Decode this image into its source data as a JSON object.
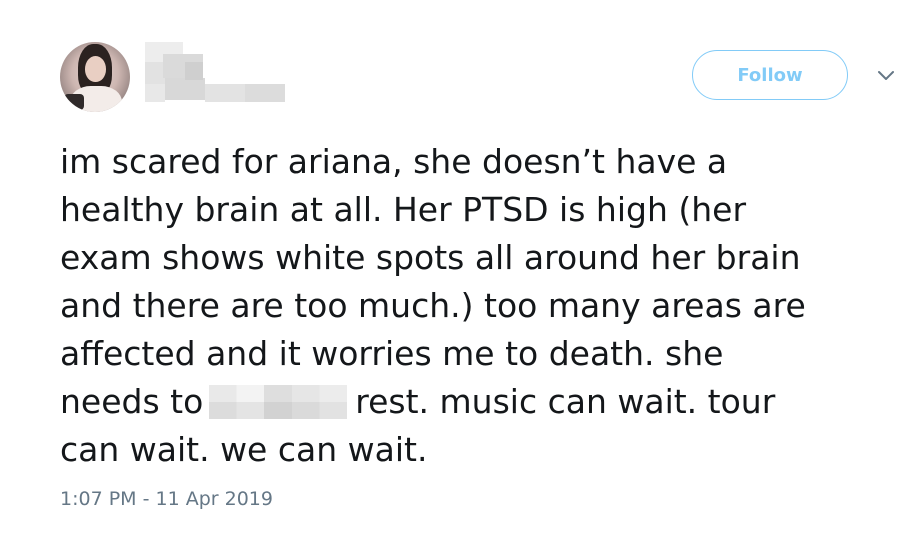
{
  "follow_button": {
    "label": "Follow"
  },
  "tweet": {
    "lines": [
      "im scared for ariana, she doesn’t have a",
      "healthy brain at all. Her PTSD is high (her",
      "exam shows white spots all around her brain",
      "and there are too much.) too many areas are",
      "affected and it worries me to death. she"
    ],
    "line6_before": "needs to",
    "line6_after": "rest. music can wait. tour",
    "line7": "can wait. we can wait."
  },
  "timestamp": "1:07 PM - 11 Apr 2019",
  "icons": {
    "caret": "chevron-down-icon",
    "avatar": "user-avatar"
  },
  "colors": {
    "accent": "#1da1f2",
    "text": "#14171a",
    "muted": "#657786"
  }
}
